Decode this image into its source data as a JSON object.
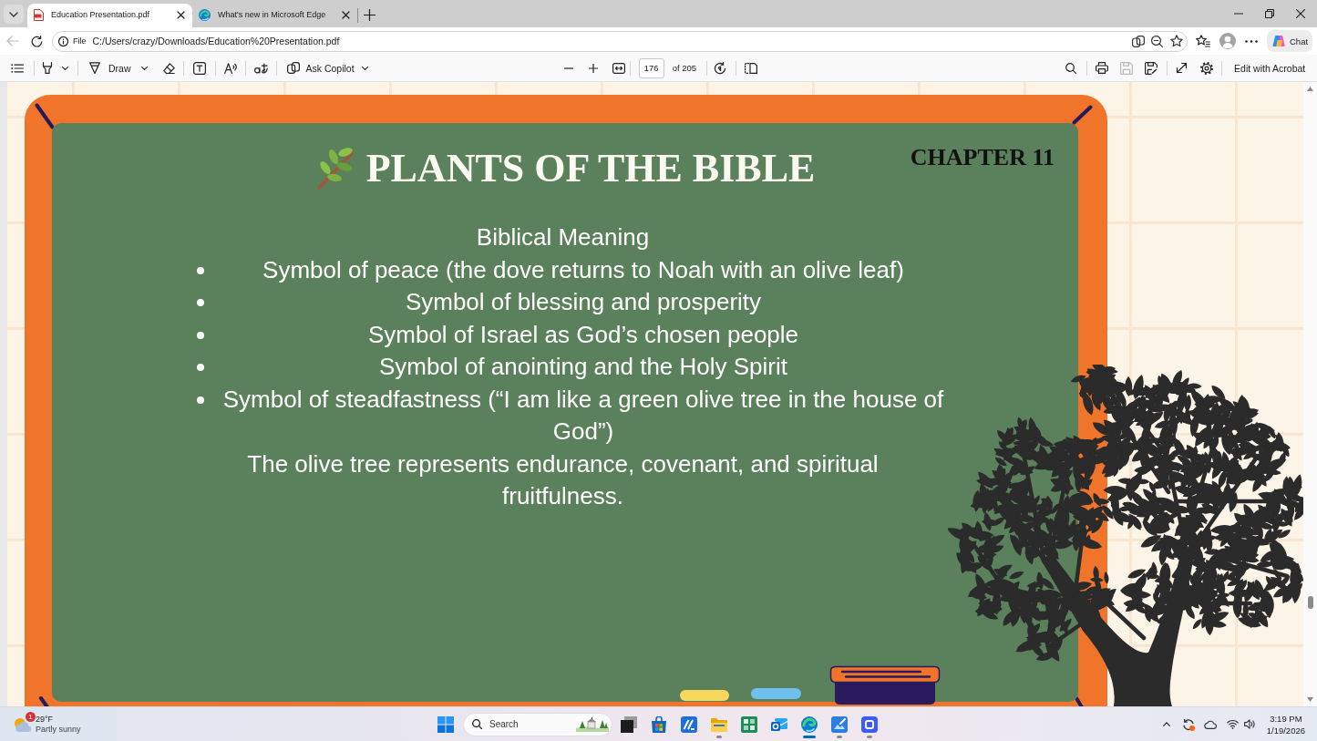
{
  "browser": {
    "tabs": [
      {
        "kind": "pdf",
        "title": "Education Presentation.pdf",
        "selected": true
      },
      {
        "kind": "web",
        "title": "What's new in Microsoft Edge",
        "selected": false
      }
    ],
    "back_disabled": true,
    "address": {
      "scheme": "File",
      "url": "C:/Users/crazy/Downloads/Education%20Presentation.pdf"
    },
    "chat_button": "Chat"
  },
  "pdf_toolbar": {
    "draw": "Draw",
    "ask_copilot": "Ask Copilot",
    "page": "176",
    "page_count": "of 205",
    "save_disabled": true,
    "edit_button": "Edit with Acrobat"
  },
  "slide": {
    "title": "PLANTS OF THE BIBLE",
    "chapter": "CHAPTER 11",
    "heading": "Biblical Meaning",
    "bullets": [
      "Symbol of peace (the dove returns to Noah with an olive leaf)",
      "Symbol of blessing and prosperity",
      "Symbol of Israel as God’s chosen people",
      "Symbol of anointing and the Holy Spirit",
      "Symbol of steadfastness (“I am like a green olive tree in the house of God”)"
    ],
    "closing": "The olive tree represents endurance, covenant, and spiritual fruitfulness."
  },
  "taskbar": {
    "weather": {
      "temperature": "29°F",
      "condition": "Partly sunny",
      "badge": "1"
    },
    "search": {
      "placeholder": "Search"
    },
    "apps": [
      {
        "kind": "task-view",
        "running": false,
        "selected": false
      },
      {
        "kind": "store",
        "running": false,
        "selected": false
      },
      {
        "kind": "slant",
        "running": false,
        "selected": false
      },
      {
        "kind": "folder",
        "running": true,
        "selected": false
      },
      {
        "kind": "grid",
        "running": false,
        "selected": false
      },
      {
        "kind": "mail",
        "running": false,
        "selected": false
      },
      {
        "kind": "browser",
        "running": true,
        "selected": true
      },
      {
        "kind": "paint",
        "running": true,
        "selected": false
      },
      {
        "kind": "square",
        "running": true,
        "selected": false
      }
    ],
    "clock": {
      "time": "3:19 PM",
      "date": "1/19/2026"
    }
  }
}
